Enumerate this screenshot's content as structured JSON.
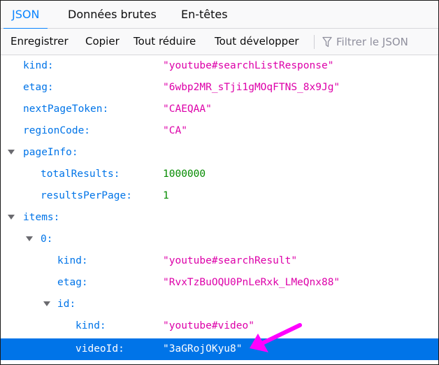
{
  "tabs": [
    {
      "label": "JSON",
      "active": true
    },
    {
      "label": "Données brutes",
      "active": false
    },
    {
      "label": "En-têtes",
      "active": false
    }
  ],
  "toolbar": {
    "save": "Enregistrer",
    "copy": "Copier",
    "collapse_all": "Tout réduire",
    "expand_all": "Tout développer",
    "filter_placeholder": "Filtrer le JSON",
    "filter_icon": "funnel-icon"
  },
  "colors": {
    "accent": "#0a84ff",
    "key": "#0074e8",
    "string": "#dd00a9",
    "number": "#058b00",
    "selection": "#0074e8",
    "annotation_arrow": "#ff00ff"
  },
  "tree": [
    {
      "key": "kind:",
      "value": "\"youtube#searchListResponse\"",
      "type": "string"
    },
    {
      "key": "etag:",
      "value": "\"6wbp2MR_sTji1gMOqFTNS_8x9Jg\"",
      "type": "string"
    },
    {
      "key": "nextPageToken:",
      "value": "\"CAEQAA\"",
      "type": "string"
    },
    {
      "key": "regionCode:",
      "value": "\"CA\"",
      "type": "string"
    },
    {
      "key": "pageInfo:",
      "value": "",
      "type": "object"
    },
    {
      "key": "totalResults:",
      "value": "1000000",
      "type": "number"
    },
    {
      "key": "resultsPerPage:",
      "value": "1",
      "type": "number"
    },
    {
      "key": "items:",
      "value": "",
      "type": "object"
    },
    {
      "key": "0:",
      "value": "",
      "type": "object"
    },
    {
      "key": "kind:",
      "value": "\"youtube#searchResult\"",
      "type": "string"
    },
    {
      "key": "etag:",
      "value": "\"RvxTzBuOQU0PnLeRxk_LMeQnx88\"",
      "type": "string"
    },
    {
      "key": "id:",
      "value": "",
      "type": "object"
    },
    {
      "key": "kind:",
      "value": "\"youtube#video\"",
      "type": "string"
    },
    {
      "key": "videoId:",
      "value": "\"3aGRojOKyu8\"",
      "type": "string",
      "selected": true
    }
  ]
}
